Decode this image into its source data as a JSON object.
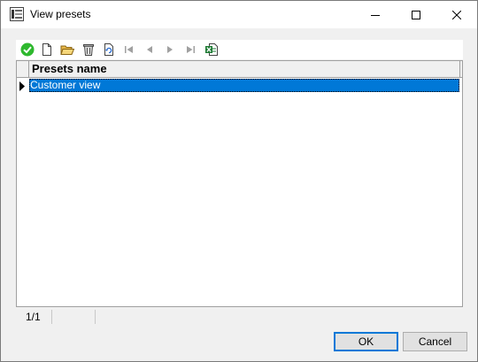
{
  "window": {
    "title": "View presets",
    "app_icon": "app-icon",
    "controls": [
      "minimize-icon",
      "maximize-icon",
      "close-icon"
    ]
  },
  "toolbar": {
    "items": [
      {
        "name": "apply-icon",
        "enabled": true
      },
      {
        "name": "new-document-icon",
        "enabled": true
      },
      {
        "name": "open-folder-icon",
        "enabled": true
      },
      {
        "name": "delete-icon",
        "enabled": true
      },
      {
        "name": "refresh-icon",
        "enabled": true
      },
      {
        "name": "first-record-icon",
        "enabled": false
      },
      {
        "name": "previous-record-icon",
        "enabled": false
      },
      {
        "name": "next-record-icon",
        "enabled": false
      },
      {
        "name": "last-record-icon",
        "enabled": false
      },
      {
        "name": "export-excel-icon",
        "enabled": true
      }
    ]
  },
  "grid": {
    "columns": [
      "Presets name"
    ],
    "rows": [
      {
        "name": "Customer view",
        "selected": true
      }
    ]
  },
  "status": {
    "record_counter": "1/1"
  },
  "buttons": {
    "ok": "OK",
    "cancel": "Cancel"
  },
  "colors": {
    "selection": "#0078d7",
    "apply_green": "#2eb82e",
    "excel_green": "#1e7b34"
  }
}
